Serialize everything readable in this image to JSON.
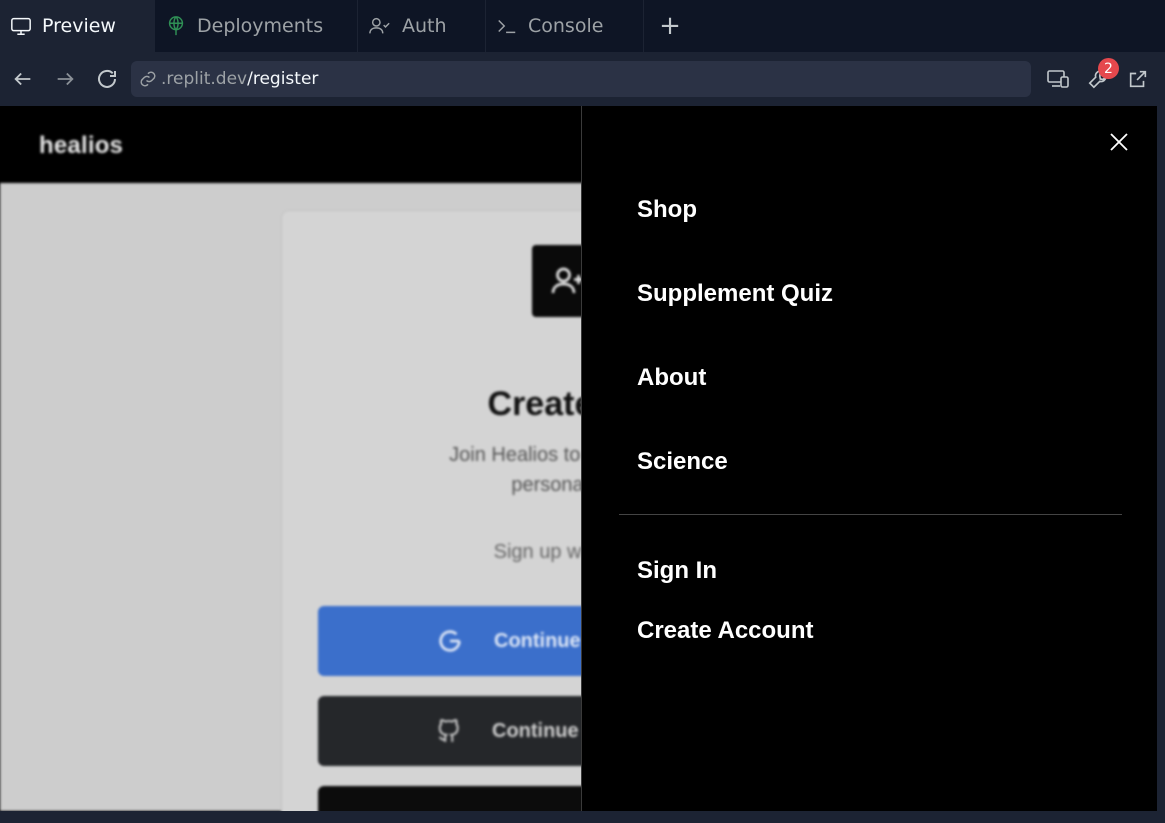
{
  "tabs": [
    {
      "label": "Preview",
      "icon": "monitor-icon",
      "active": true
    },
    {
      "label": "Deployments",
      "icon": "deploy-icon",
      "active": false
    },
    {
      "label": "Auth",
      "icon": "user-check-icon",
      "active": false
    },
    {
      "label": "Console",
      "icon": "terminal-icon",
      "active": false
    }
  ],
  "tab_add_label": "+",
  "url": {
    "domain": ".replit.dev",
    "path": "/register"
  },
  "toolbar": {
    "devtools_badge": "2"
  },
  "site": {
    "logo": "healios",
    "card": {
      "title": "Create your",
      "subtitle_line1": "Join Healios to access premiu",
      "subtitle_line2": "personalised he",
      "signup_text": "Sign up with your pr",
      "google_label": "Continue",
      "github_label": "Continue"
    }
  },
  "menu": {
    "items": [
      "Shop",
      "Supplement Quiz",
      "About",
      "Science"
    ],
    "sign_in": "Sign In",
    "create_account": "Create Account"
  },
  "colors": {
    "accent_blue": "#3b6fcb",
    "badge_red": "#e5484d",
    "chrome_bg": "#1c2333"
  }
}
